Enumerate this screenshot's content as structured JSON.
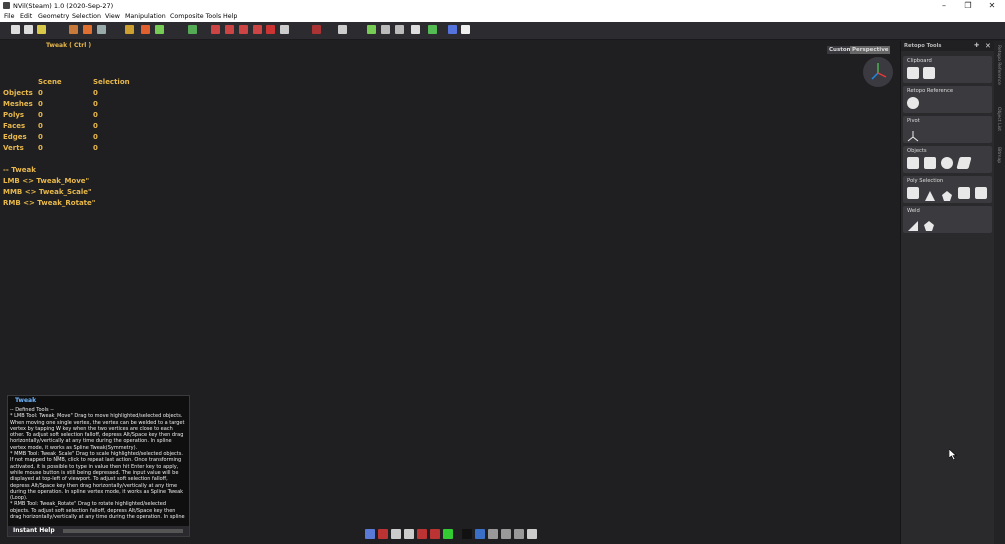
{
  "window": {
    "title": "NVil(Steam) 1.0 (2020-Sep-27)",
    "minimize": "–",
    "maximize": "❐",
    "close": "✕"
  },
  "menu": [
    "File",
    "Edit",
    "Geometry",
    "Selection",
    "View",
    "Manipulation",
    "Composite Tools",
    "Help"
  ],
  "viewport": {
    "tool_header": "Tweak  ( Ctrl )",
    "view_custom": "Custom",
    "view_perspective": "Perspective",
    "stats": {
      "headers": [
        "",
        "Scene",
        "Selection"
      ],
      "rows": [
        {
          "label": "Objects",
          "scene": "0",
          "selection": "0"
        },
        {
          "label": "Meshes",
          "scene": "0",
          "selection": "0"
        },
        {
          "label": "Polys",
          "scene": "0",
          "selection": "0"
        },
        {
          "label": "Faces",
          "scene": "0",
          "selection": "0"
        },
        {
          "label": "Edges",
          "scene": "0",
          "selection": "0"
        },
        {
          "label": "Verts",
          "scene": "0",
          "selection": "0"
        }
      ]
    },
    "bindings": [
      "-- Tweak",
      "LMB <> Tweak_Move\"",
      "MMB <> Tweak_Scale\"",
      "RMB <> Tweak_Rotate\""
    ]
  },
  "help": {
    "title": "Tweak",
    "lines": [
      "-- Defined Tools --",
      "* LMB Tool: Tweak_Move\"    Drag to move highlighted/selected objects. When moving one single vertex, the vertex can be welded to a target vertex by tapping W key when the two vertices are close to each other. To adjust soft selection falloff, depress Alt/Space key then drag horizontally/vertically at any time during the operation. In spline vertex mode, it works as Spline Tweak(Symmetry).",
      "* MMB Tool: Tweak_Scale\"    Drag to scale highlighted/selected objects. If not mapped to NMB, click to repeat last action. Once transforming activated, it is possible to type in value then hit Enter key to apply, while mouse button is still being depressed. The input value will be displayed at top-left of viewport. To adjust soft selection falloff, depress Alt/Space key then drag horizontally/vertically at any time during the operation. In spline vertex mode, it works as Spline Tweak (Loop).",
      "* RMB Tool: Tweak_Rotate\"    Drag to rotate highlighted/selected objects. To adjust soft selection falloff, depress Alt/Space key then drag horizontally/vertically at any time during the operation. In spline"
    ],
    "footer": "Instant Help"
  },
  "retopo": {
    "title": "Retopo Tools",
    "pin_icon": "pin-icon",
    "close": "✕",
    "groups": [
      {
        "label": "Clipboard",
        "icons": 2
      },
      {
        "label": "Retopo Reference",
        "icons": 1
      },
      {
        "label": "Pivot",
        "icons": 1
      },
      {
        "label": "Objects",
        "icons": 4
      },
      {
        "label": "Poly Selection",
        "icons": 5
      },
      {
        "label": "Weld",
        "icons": 2
      }
    ]
  },
  "side_tabs": [
    "Retopo Reference",
    "Object List",
    "Bitmap"
  ],
  "colors": {
    "accent_yellow": "#e8b84a",
    "help_title": "#6fb7ff",
    "viewport_bg": "#1f1f22",
    "panel_bg": "#2a2a2d"
  }
}
